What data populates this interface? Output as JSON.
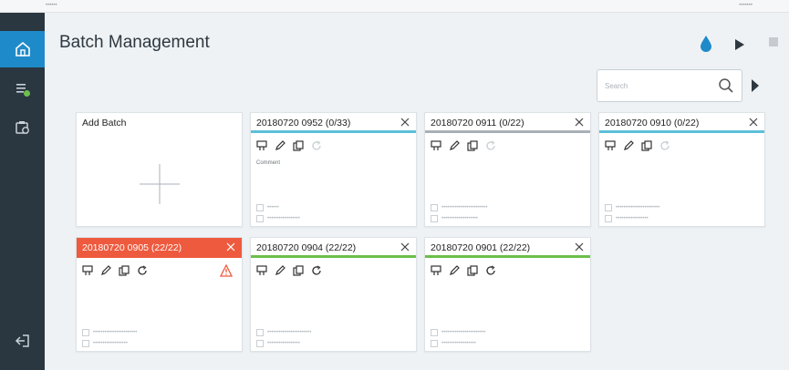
{
  "window": {
    "left_text": "••••••",
    "right_text": "•••••••"
  },
  "header": {
    "title": "Batch Management"
  },
  "search": {
    "placeholder": "Search"
  },
  "add_card": {
    "label": "Add Batch"
  },
  "batches": [
    {
      "title": "20180720 0952 (0/33)",
      "status": "blue",
      "comment": "Comment",
      "meta1": "••••••",
      "meta2": "•••••••••••••••••"
    },
    {
      "title": "20180720 0911 (0/22)",
      "status": "gray",
      "comment": "",
      "meta1": "••••••••••••••••••••••••",
      "meta2": "•••••••••••••••••••"
    },
    {
      "title": "20180720 0910 (0/22)",
      "status": "blue",
      "comment": "",
      "meta1": "•••••••••••••••••••••••",
      "meta2": "•••••••••••••••••"
    },
    {
      "title": "20180720 0905 (22/22)",
      "status": "red",
      "comment": "",
      "meta1": "•••••••••••••••••••••••",
      "meta2": "••••••••••••••••••"
    },
    {
      "title": "20180720 0904 (22/22)",
      "status": "green",
      "comment": "",
      "meta1": "•••••••••••••••••••••••",
      "meta2": "•••••••••••••••••"
    },
    {
      "title": "20180720 0901 (22/22)",
      "status": "green",
      "comment": "",
      "meta1": "•••••••••••••••••••••••",
      "meta2": "••••••••••••••••••"
    }
  ],
  "colors": {
    "accent": "#1f8ac9",
    "sidebar": "#2a3640",
    "error": "#ee5a3e",
    "running": "#5bbfd8",
    "complete": "#6cbf4b"
  },
  "icons": {
    "sidebar": [
      "home-icon",
      "batch-list-icon",
      "device-icon",
      "logout-icon"
    ],
    "header": [
      "drop-icon",
      "play-icon",
      "stop-icon"
    ],
    "card_actions": [
      "settings-icon",
      "edit-icon",
      "copy-icon",
      "refresh-icon"
    ]
  }
}
